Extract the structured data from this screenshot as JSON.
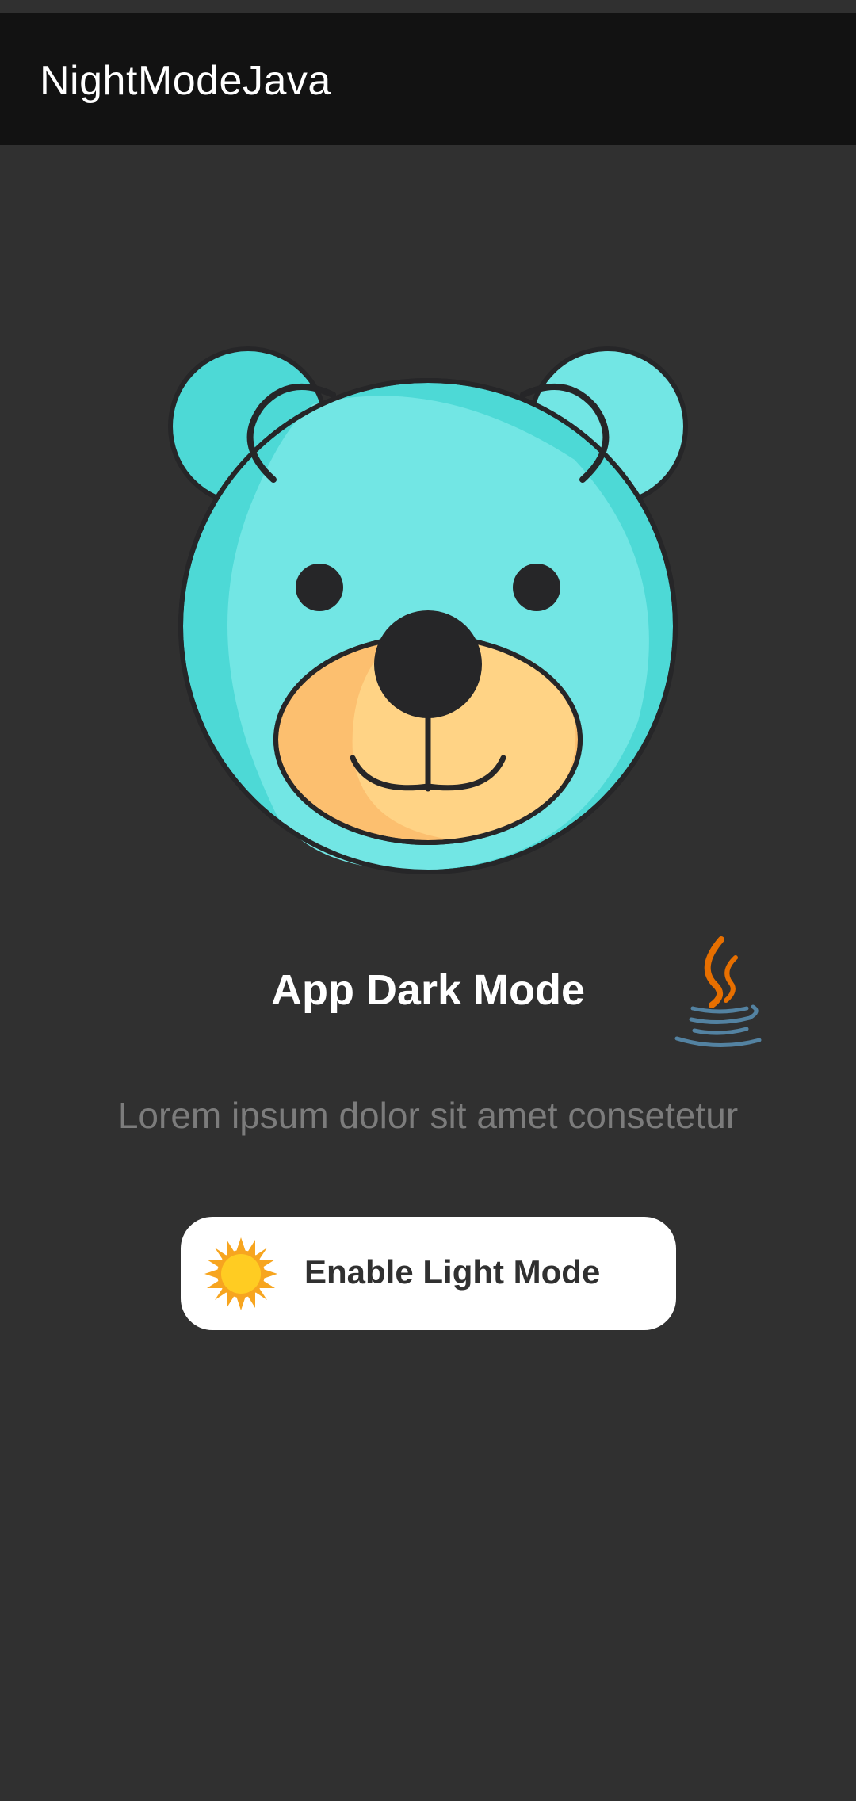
{
  "app_bar": {
    "title": "NightModeJava"
  },
  "main": {
    "heading": "App Dark Mode",
    "subtitle": "Lorem ipsum dolor sit amet consetetur",
    "toggle_button": {
      "label": "Enable Light Mode",
      "icon": "sun-icon"
    },
    "illustration": {
      "icon": "bear-icon"
    },
    "logo": {
      "icon": "java-logo-icon"
    }
  },
  "colors": {
    "background": "#303030",
    "app_bar": "#121212",
    "bear_face": "#72e6e4",
    "bear_shade": "#4dd9d6",
    "muzzle": "#ffd385",
    "muzzle_shade": "#fcbf6f",
    "outline": "#262628",
    "subtitle": "#7c7c7c",
    "sun": "#ffcc22",
    "sun_rays": "#f7a51f",
    "java_orange": "#e76f00",
    "java_blue": "#5382a1"
  }
}
